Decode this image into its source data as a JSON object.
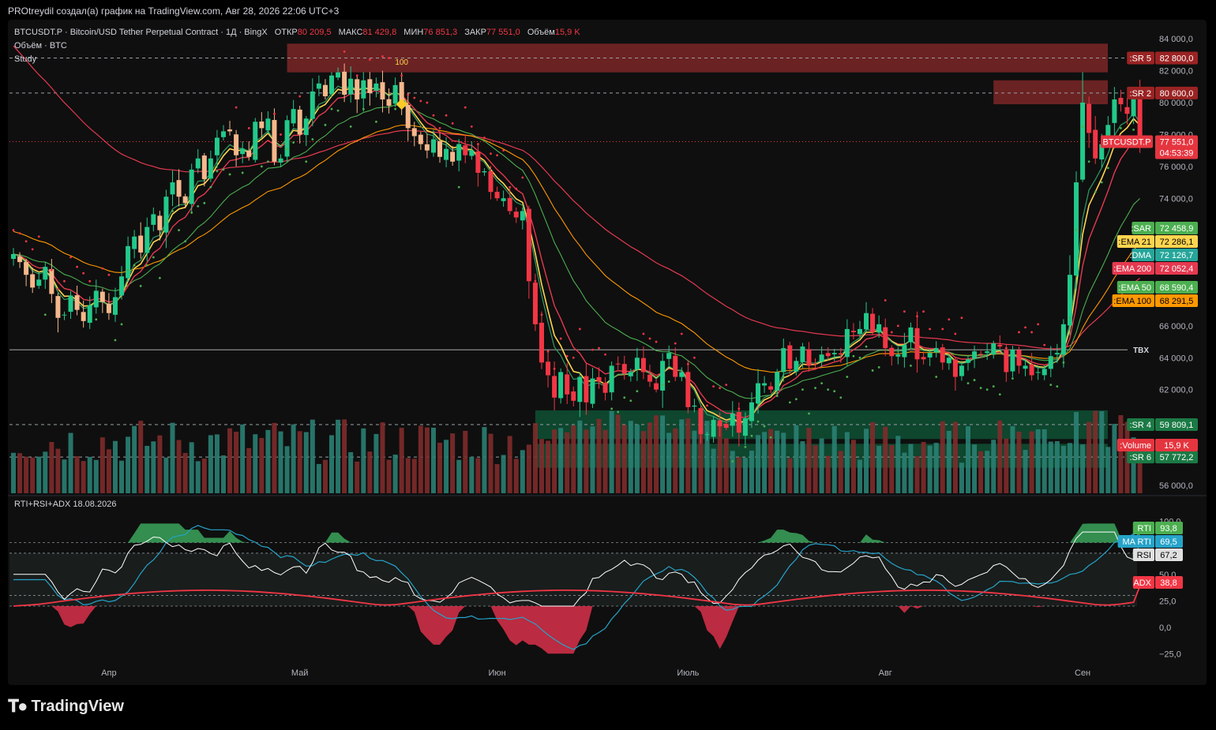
{
  "caption": "PROtreydil создал(а) график на TradingView.com, Авг 28, 2026 22:06 UTC+3",
  "legend": {
    "symbol": "BTCUSDT.P · Bitcoin/USD Tether Perpetual Contract · 1Д · BingX",
    "open_label": "ОТКР",
    "open": "80 209,5",
    "high_label": "МАКС",
    "high": "81 429,8",
    "low_label": "МИН",
    "low": "76 851,3",
    "close_label": "ЗАКР",
    "close": "77 551,0",
    "vol_label": "Объём",
    "vol": "15,9 K",
    "volume_line": "Объём · BTC",
    "study_line": "Study",
    "indicator_line": "RTI+RSI+ADX 18.08.2026"
  },
  "footer": {
    "logo_text": "TradingView",
    "logo_icon": "tradingview-logo-icon"
  },
  "colors": {
    "up": "#22c98a",
    "down": "#f23645",
    "up_dim": "#2a7f73",
    "down_dim": "#7f2b2b",
    "ema21": "#ffd54f",
    "ema50": "#4caf50",
    "ema100": "#ff9800",
    "ema200": "#e53950",
    "sar": "#f23645",
    "rti": "#ffffff",
    "ma_rti": "#26a3c9",
    "adx": "#f23645",
    "sr_red": "#8b2a2a",
    "sr_green": "#0f5a3a"
  },
  "chart_data": {
    "type": "candlestick",
    "symbol": "BTCUSDT.P",
    "timeframe": "1Д",
    "price_range": [
      55500,
      85200
    ],
    "x_labels": [
      {
        "label": "Апр",
        "day": 3
      },
      {
        "label": "Май",
        "day": 33
      },
      {
        "label": "Июн",
        "day": 64
      },
      {
        "label": "Июль",
        "day": 94
      },
      {
        "label": "Авг",
        "day": 125
      },
      {
        "label": "Сен",
        "day": 156
      }
    ],
    "price_ticks": [
      "84 000,0",
      "82 000,0",
      "80 000,0",
      "78 000,0",
      "76 000,0",
      "74 000,0",
      "66 000,0",
      "64 000,0",
      "62 000,0",
      "56 000,0"
    ],
    "price_tick_values": [
      84000,
      82000,
      80000,
      78000,
      76000,
      74000,
      66000,
      64000,
      62000,
      56000
    ],
    "day_count": 164,
    "candles_first_day": -12,
    "closes": [
      70500,
      70000,
      69200,
      68400,
      68900,
      69700,
      68000,
      66500,
      66700,
      67900,
      67000,
      66300,
      67300,
      68200,
      67500,
      66800,
      67800,
      69100,
      71000,
      71600,
      70600,
      72200,
      73000,
      72000,
      74100,
      75000,
      74100,
      73700,
      75800,
      76500,
      75200,
      76500,
      77800,
      78200,
      78200,
      76700,
      77100,
      76600,
      78800,
      78400,
      79000,
      76300,
      76500,
      78900,
      79600,
      78000,
      79000,
      80700,
      81200,
      80400,
      81700,
      81900,
      80500,
      81500,
      80200,
      81400,
      80600,
      81200,
      80200,
      79800,
      81100,
      79900,
      78400,
      77900,
      77400,
      77000,
      77700,
      76600,
      77100,
      76300,
      77400,
      76700,
      77000,
      75600,
      75700,
      74400,
      74000,
      74000,
      73200,
      72800,
      73200,
      68800,
      66100,
      63700,
      62900,
      61500,
      63100,
      61700,
      61300,
      62800,
      61200,
      62700,
      62500,
      61800,
      63500,
      63600,
      63000,
      63100,
      64000,
      63100,
      62500,
      62000,
      63800,
      64300,
      62800,
      63100,
      60900,
      61000,
      59200,
      59200,
      60100,
      59700,
      59600,
      60500,
      59300,
      60200,
      61200,
      62400,
      62400,
      62000,
      63100,
      64600,
      63300,
      63800,
      64700,
      63500,
      63600,
      64200,
      64100,
      64300,
      64200,
      65800,
      65600,
      65800,
      66800,
      65600,
      66100,
      64600,
      64100,
      64200,
      64800,
      65900,
      63900,
      63900,
      64300,
      64600,
      63700,
      64000,
      62800,
      63500,
      63900,
      64400,
      64200,
      64400,
      64900,
      64700,
      63100,
      64500,
      63500,
      63500,
      62900,
      63100,
      63300,
      64100
    ],
    "closes_tail": [
      64300,
      66100,
      69200,
      75000,
      80000,
      78100,
      76500,
      77400,
      78600,
      80200,
      79900,
      79300,
      80400,
      77551
    ],
    "last_price": "77 551,0",
    "countdown": "04:53:39",
    "indicators": [
      {
        "name": "SAR",
        "value": "72 458,9",
        "color": "#4caf50"
      },
      {
        "name": "EMA 21",
        "value": "72 286,1",
        "color": "#ffd54f"
      },
      {
        "name": "DMA",
        "value": "72 126,7",
        "color": "#26a69a"
      },
      {
        "name": "EMA 200",
        "value": "72 052,4",
        "color": "#e53950"
      },
      {
        "name": "EMA 50",
        "value": "68 590,4",
        "color": "#4caf50"
      },
      {
        "name": "EMA 100",
        "value": "68 291,5",
        "color": "#ff9800"
      }
    ],
    "levels": [
      {
        "name": "SR 5",
        "value": "82 800,0",
        "price": 82800,
        "zone": [
          81900,
          83700
        ],
        "zone_color": "red",
        "from_day": 31
      },
      {
        "name": "SR 2",
        "value": "80 600,0",
        "price": 80600,
        "zone": [
          79900,
          81400
        ],
        "zone_color": "red",
        "from_day": 142
      },
      {
        "name": "SR 4",
        "value": "59 809,1",
        "price": 59809,
        "zone": [
          58900,
          60700
        ],
        "zone_color": "green",
        "from_day": 70
      },
      {
        "name": "SR 6",
        "value": "57 772,2",
        "price": 57772,
        "zone": [
          57100,
          58600
        ],
        "zone_color": "green",
        "from_day": 70
      }
    ],
    "horizontal_line": {
      "label": "TBX",
      "price": 64500
    },
    "volume_label": {
      "name": "Volume",
      "value": "15,9 K"
    },
    "annotation": {
      "text": "100",
      "day": 49
    },
    "indicator_panel": {
      "title": "RTI+RSI+ADX 18.08.2026",
      "range": [
        -30,
        108
      ],
      "ticks": [
        "100,0",
        "50,0",
        "25,0",
        "0,0",
        "−25,0"
      ],
      "tick_values": [
        100,
        50,
        25,
        0,
        -25
      ],
      "dashed_levels": [
        80,
        70,
        30,
        20
      ],
      "values": [
        {
          "name": "RTI",
          "value": "93,8",
          "color": "#4caf50"
        },
        {
          "name": "MA RTI",
          "value": "69,5",
          "color": "#26a3c9"
        },
        {
          "name": "RSI",
          "value": "67,2",
          "color": "#e0e0e0"
        },
        {
          "name": "ADX",
          "value": "38,8",
          "color": "#f23645"
        }
      ]
    }
  }
}
